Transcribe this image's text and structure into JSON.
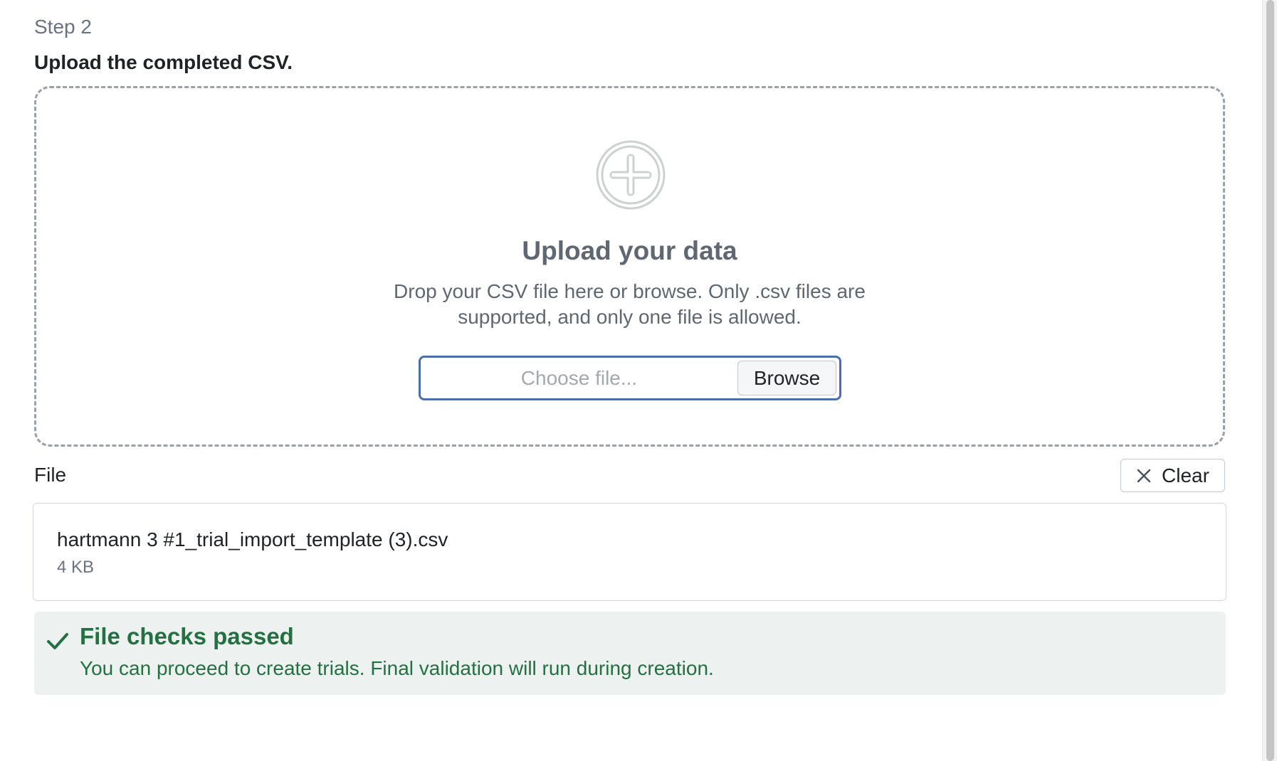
{
  "step": {
    "label": "Step 2",
    "title": "Upload the completed CSV."
  },
  "dropzone": {
    "icon": "plus-circle-icon",
    "heading": "Upload your data",
    "description": "Drop your CSV file here or browse. Only .csv files are supported, and only one file is allowed.",
    "file_input": {
      "placeholder": "Choose file...",
      "browse_label": "Browse"
    }
  },
  "file_section": {
    "label": "File",
    "clear_icon": "close-icon",
    "clear_label": "Clear",
    "file": {
      "name": "hartmann 3 #1_trial_import_template (3).csv",
      "size": "4 KB"
    }
  },
  "alert": {
    "icon": "checkmark-icon",
    "title": "File checks passed",
    "message": "You can proceed to create trials. Final validation will run during creation.",
    "color": "#237042",
    "background": "#edf2f0"
  }
}
